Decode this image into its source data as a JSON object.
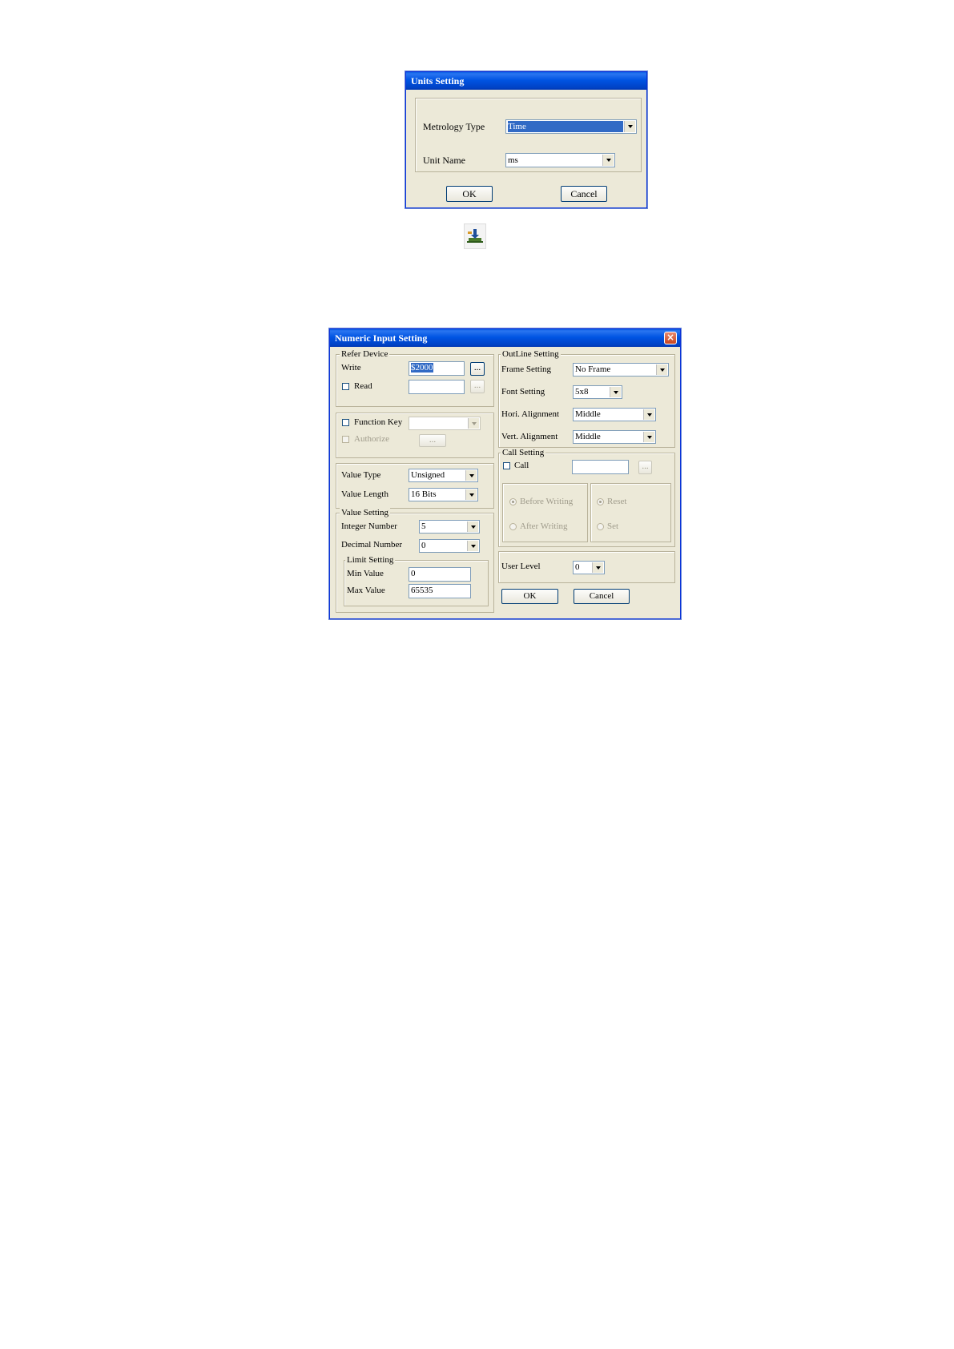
{
  "units_dialog": {
    "title": "Units Setting",
    "metrology_type_label": "Metrology Type",
    "metrology_type_value": "Time",
    "unit_name_label": "Unit Name",
    "unit_name_value": "ms",
    "ok_label": "OK",
    "cancel_label": "Cancel"
  },
  "toolbar_icon": "numeric-input-icon",
  "numeric_dialog": {
    "title": "Numeric Input Setting",
    "refer_device": {
      "group_label": "Refer Device",
      "write_label": "Write",
      "write_value": "$2000",
      "read_label": "Read",
      "read_value": "",
      "browse_label": "..."
    },
    "function_key": {
      "function_key_label": "Function Key",
      "function_key_value": "",
      "authorize_label": "Authorize",
      "authorize_button_label": "..."
    },
    "value_type": {
      "value_type_label": "Value Type",
      "value_type_value": "Unsigned",
      "value_length_label": "Value Length",
      "value_length_value": "16 Bits"
    },
    "value_setting": {
      "group_label": "Value Setting",
      "integer_label": "Integer Number",
      "integer_value": "5",
      "decimal_label": "Decimal Number",
      "decimal_value": "0",
      "limit_group_label": "Limit Setting",
      "min_label": "Min Value",
      "min_value": "0",
      "max_label": "Max Value",
      "max_value": "65535"
    },
    "outline": {
      "group_label": "OutLine Setting",
      "frame_label": "Frame Setting",
      "frame_value": "No Frame",
      "font_label": "Font Setting",
      "font_value": "5x8",
      "hori_label": "Hori. Alignment",
      "hori_value": "Middle",
      "vert_label": "Vert. Alignment",
      "vert_value": "Middle"
    },
    "call_setting": {
      "group_label": "Call Setting",
      "call_label": "Call",
      "call_value": "",
      "browse_label": "...",
      "before_writing_label": "Before Writing",
      "after_writing_label": "After Writing",
      "reset_label": "Reset",
      "set_label": "Set"
    },
    "user_level_label": "User Level",
    "user_level_value": "0",
    "ok_label": "OK",
    "cancel_label": "Cancel",
    "close_glyph": "×"
  }
}
